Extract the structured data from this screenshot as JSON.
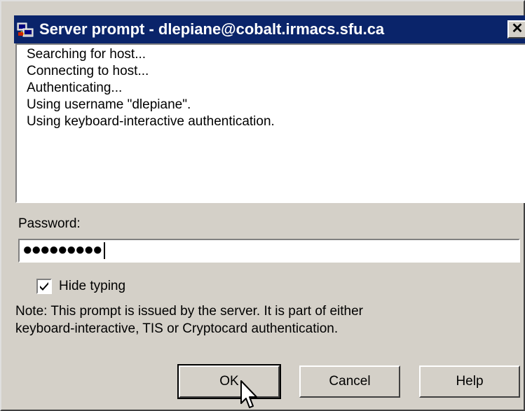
{
  "window": {
    "title": "Server prompt - dlepiane@cobalt.irmacs.sfu.ca",
    "close_label": "✕",
    "icon": "putty-app-icon"
  },
  "log": {
    "lines": [
      "Searching for host...",
      "Connecting to host...",
      "Authenticating...",
      "Using username \"dlepiane\".",
      "Using keyboard-interactive authentication."
    ]
  },
  "password": {
    "label": "Password:",
    "masked_value": "●●●●●●●●●"
  },
  "hide_typing": {
    "label": "Hide typing",
    "checked": true
  },
  "note": {
    "line1": "Note: This prompt is issued by the server. It is part of either",
    "line2": "keyboard-interactive, TIS or Cryptocard authentication."
  },
  "buttons": {
    "ok": "OK",
    "cancel": "Cancel",
    "help": "Help"
  },
  "colors": {
    "titlebar": "#0a246a",
    "dialog_face": "#d4d0c8"
  }
}
